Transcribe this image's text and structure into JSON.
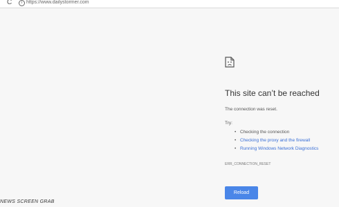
{
  "browser": {
    "reload_glyph": "C",
    "url_icon": "info-icon",
    "url_icon_glyph": "i",
    "url": "https://www.dailystormer.com"
  },
  "error_page": {
    "icon": "sad-document-icon",
    "title": "This site can’t be reached",
    "subtitle": "The connection was reset.",
    "try_label": "Try:",
    "suggestions": [
      {
        "label": "Checking the connection",
        "is_link": false
      },
      {
        "label": "Checking the proxy and the firewall",
        "is_link": true
      },
      {
        "label": "Running Windows Network Diagnostics",
        "is_link": true
      }
    ],
    "error_code": "ERR_CONNECTION_RESET",
    "reload_label": "Reload"
  },
  "caption": "NEWS SCREEN GRAB",
  "colors": {
    "link": "#3a6fd6",
    "button": "#4a86e8",
    "background": "#f7f7f7"
  }
}
